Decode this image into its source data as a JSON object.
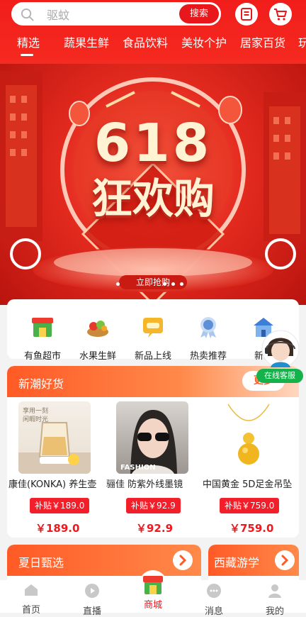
{
  "search": {
    "placeholder": "驱蚊",
    "button_label": "搜索"
  },
  "tabs": [
    "精选",
    "蔬果生鲜",
    "食品饮料",
    "美妆个护",
    "居家百货",
    "玩"
  ],
  "banner": {
    "headline_top": "618",
    "headline_bottom": "狂欢购",
    "cta": "立即抢购"
  },
  "categories": [
    "有鱼超市",
    "水果生鲜",
    "新品上线",
    "热卖推荐",
    "新疆"
  ],
  "service": {
    "label": "在线客服"
  },
  "trending": {
    "title": "新潮好货",
    "more_label": "更多",
    "products": [
      {
        "name": "康佳(KONKA) 养生壶",
        "badge": "补贴￥189.0",
        "price": "￥189.0",
        "img_text_1": "享用一刻",
        "img_text_2": "闲暇时光"
      },
      {
        "name": "骊佳 防紫外线墨镜",
        "badge": "补贴￥92.9",
        "price": "￥92.9",
        "img_text_1": "FASHION"
      },
      {
        "name": "中国黄金 5D足金吊坠",
        "badge": "补贴￥759.0",
        "price": "￥759.0"
      }
    ]
  },
  "sections": {
    "summer": "夏日甄选",
    "tibet": "西藏游学"
  },
  "nav": [
    {
      "label": "首页",
      "icon": "home-icon"
    },
    {
      "label": "直播",
      "icon": "live-icon"
    },
    {
      "label": "商城",
      "icon": "mall-icon",
      "active": true
    },
    {
      "label": "消息",
      "icon": "message-icon"
    },
    {
      "label": "我的",
      "icon": "profile-icon"
    }
  ],
  "colors": {
    "brand_red": "#f11d1b",
    "price_red": "#f0181e",
    "section_orange": "#ff6a2a",
    "service_green": "#14b24a"
  }
}
